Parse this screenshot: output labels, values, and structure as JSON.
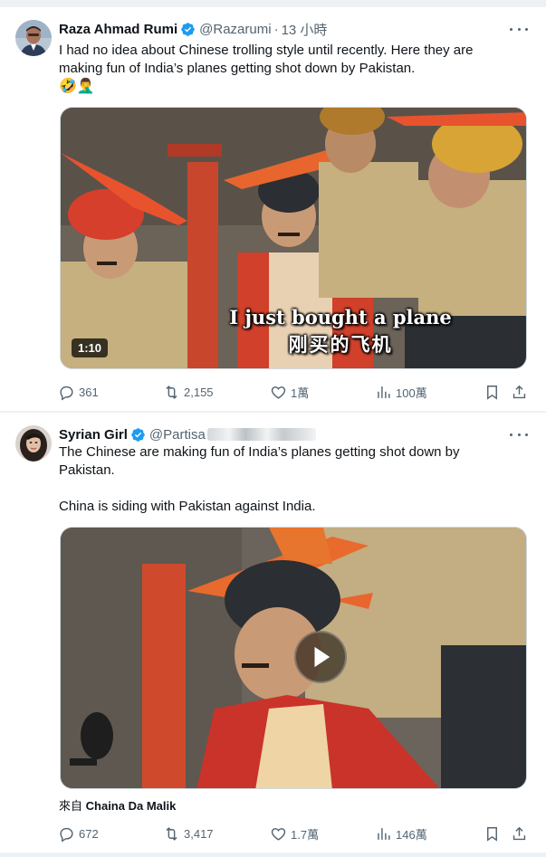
{
  "tweets": [
    {
      "name": "Raza Ahmad Rumi",
      "handle": "@Razarumi",
      "time": "13 小時",
      "text_line1": "I had no idea about Chinese trolling style until recently. Here they are",
      "text_line2": "making fun of India’s planes getting shot down by Pakistan.",
      "emojis": "🤣🤦‍♂️",
      "media": {
        "duration": "1:10",
        "subtitle_en": "I just bought a plane",
        "subtitle_zh": "刚买的飞机"
      },
      "stats": {
        "replies": "361",
        "reposts": "2,155",
        "likes": "1萬",
        "views": "100萬"
      }
    },
    {
      "name": "Syrian Girl",
      "handle": "@Partisa",
      "text_line1": "The Chinese are making fun of India’s planes getting shot down by",
      "text_line2": "Pakistan.",
      "text_line3": "China is siding with Pakistan against India.",
      "source_prefix": "來自",
      "source_name": "Chaina Da Malik",
      "stats": {
        "replies": "672",
        "reposts": "3,417",
        "likes": "1.7萬",
        "views": "146萬"
      }
    }
  ],
  "icons": {
    "verified_color": "#1d9bf0",
    "muted_color": "#536471"
  }
}
